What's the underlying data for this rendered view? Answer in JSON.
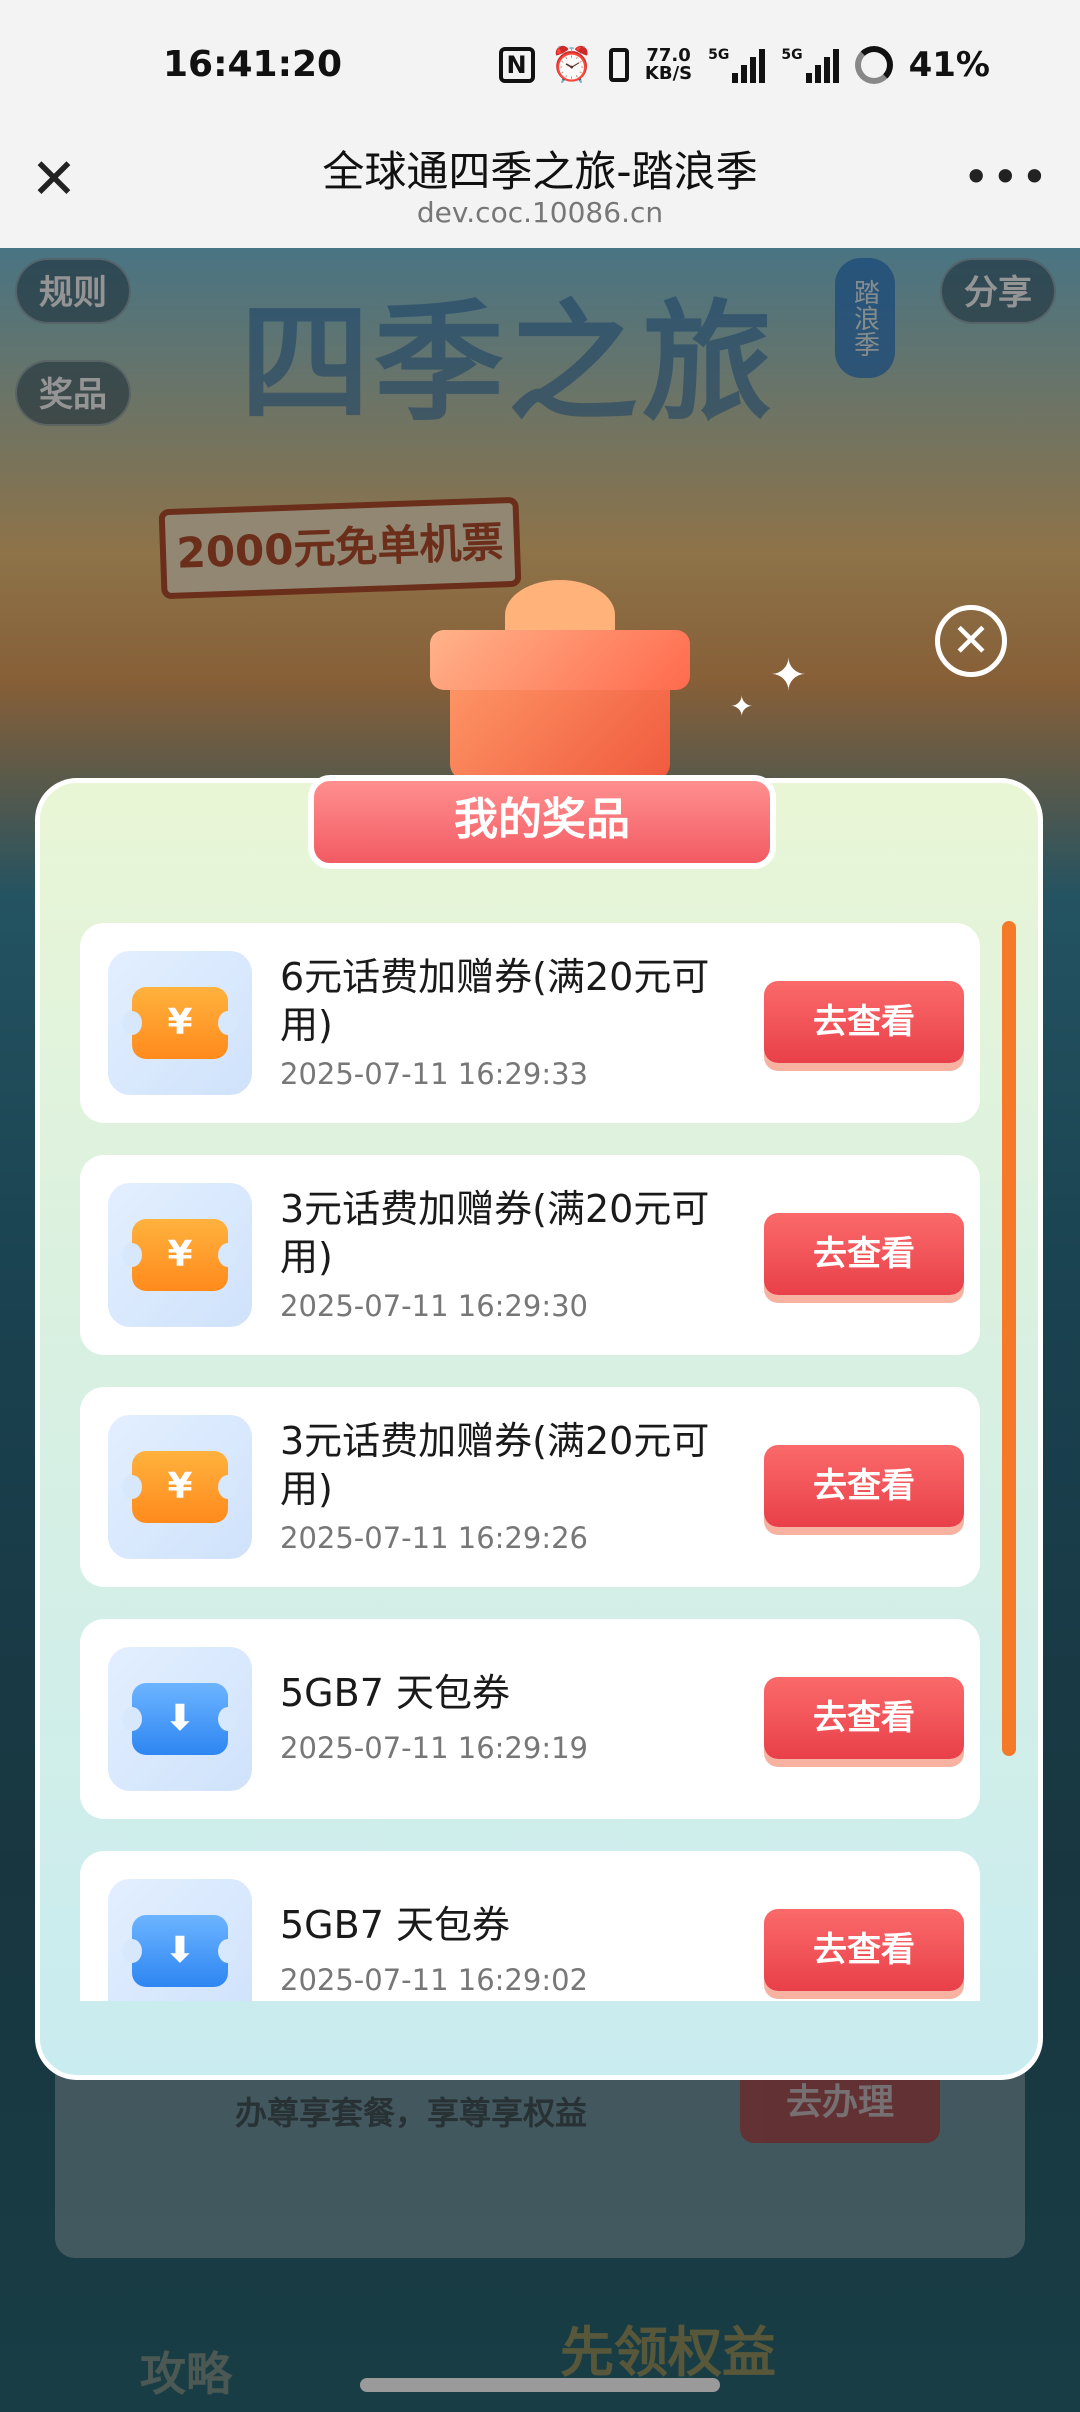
{
  "status_bar": {
    "time": "16:41:20",
    "net_speed_value": "77.0",
    "net_speed_unit": "KB/S",
    "network_1": "5G",
    "network_2": "5G",
    "battery": "41%",
    "icons": [
      "nfc-icon",
      "alarm-icon",
      "vibrate-icon",
      "signal-icon",
      "battery-icon"
    ]
  },
  "nav": {
    "title": "全球通四季之旅-踏浪季",
    "url": "dev.coc.10086.cn",
    "close_symbol": "✕",
    "more_symbol": "•••"
  },
  "background": {
    "rules_label": "规则",
    "prizes_label": "奖品",
    "share_label": "分享",
    "hero_title": "四季之旅",
    "season_badge": "踏浪季",
    "ticket_banner": "2000元免单机票",
    "vip_text": "办尊享套餐，享尊享权益",
    "vip_button": "去办理",
    "footer_left": "攻略",
    "footer_right": "先领权益"
  },
  "modal": {
    "title": "我的奖品",
    "close_symbol": "✕",
    "scroll_position": 0,
    "items": [
      {
        "name": "6元话费加赠券(满20元可用)",
        "date": "2025-07-11 16:29:33",
        "button": "去查看",
        "icon": "yuan-coupon-icon",
        "glyph": "¥"
      },
      {
        "name": "3元话费加赠券(满20元可用)",
        "date": "2025-07-11 16:29:30",
        "button": "去查看",
        "icon": "yuan-coupon-icon",
        "glyph": "¥"
      },
      {
        "name": "3元话费加赠券(满20元可用)",
        "date": "2025-07-11 16:29:26",
        "button": "去查看",
        "icon": "yuan-coupon-icon",
        "glyph": "¥"
      },
      {
        "name": "5GB7 天包券",
        "date": "2025-07-11 16:29:19",
        "button": "去查看",
        "icon": "data-coupon-icon",
        "glyph": "⬇"
      },
      {
        "name": "5GB7 天包券",
        "date": "2025-07-11 16:29:02",
        "button": "去查看",
        "icon": "data-coupon-icon",
        "glyph": "⬇"
      }
    ]
  },
  "colors": {
    "accent_red": "#f25b63",
    "scrollbar": "#f47a2a",
    "coupon_orange": "#ff8a1c",
    "coupon_blue": "#2e86f2"
  }
}
